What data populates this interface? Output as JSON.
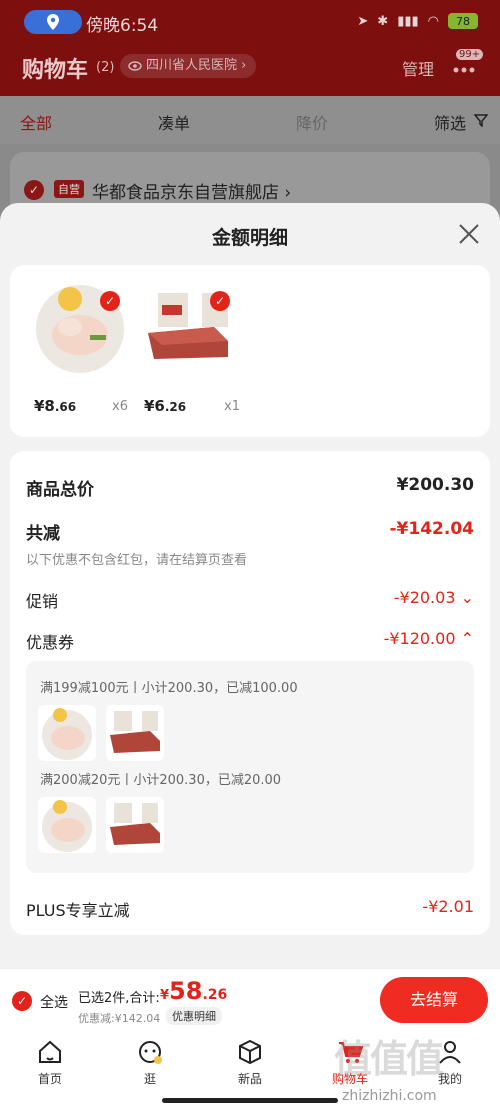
{
  "status_bar": {
    "time": "傍晚6:54",
    "battery": "78"
  },
  "header": {
    "title": "购物车",
    "count": "(2)",
    "address": "四川省人民医院",
    "manage": "管理",
    "badge": "99+"
  },
  "tabs": [
    "全部",
    "凑单",
    "降价",
    "筛选"
  ],
  "shop": {
    "tag": "自营",
    "name": "华都食品京东自营旗舰店"
  },
  "sheet": {
    "title": "金额明细",
    "items": [
      {
        "price_int": "¥8",
        "price_dec": ".66",
        "qty": "x6"
      },
      {
        "price_int": "¥6",
        "price_dec": ".26",
        "qty": "x1"
      }
    ],
    "total_label": "商品总价",
    "total_value": "¥200.30",
    "reduce_label": "共减",
    "reduce_value": "-¥142.04",
    "reduce_note": "以下优惠不包含红包，请在结算页查看",
    "promo_label": "促销",
    "promo_value": "-¥20.03",
    "coupon_label": "优惠券",
    "coupon_value": "-¥120.00",
    "coupon_lines": [
      "满199减100元丨小计200.30，已减100.00",
      "满200减20元丨小计200.30，已减20.00"
    ],
    "plus_label": "PLUS专享立减",
    "plus_value": "-¥2.01"
  },
  "bottom": {
    "select_all": "全选",
    "selected": "已选2件,合计:",
    "total_symbol": "¥",
    "total_int": "58",
    "total_dec": ".26",
    "discount": "优惠减:¥142.04",
    "detail_btn": "优惠明细",
    "checkout": "去结算"
  },
  "nav": [
    {
      "label": "首页"
    },
    {
      "label": "逛"
    },
    {
      "label": "新品"
    },
    {
      "label": "购物车"
    },
    {
      "label": "我的"
    }
  ],
  "watermark": {
    "big": "值值值",
    "small": "zhizhizhi.com"
  },
  "colors": {
    "accent": "#e2231a",
    "header": "#7d0f0f"
  }
}
